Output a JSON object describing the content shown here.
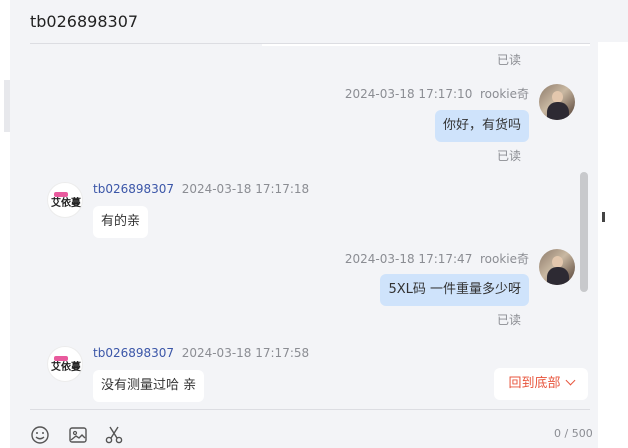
{
  "header": {
    "title": "tb026898307"
  },
  "read_label": "已读",
  "messages": [
    {
      "sender": "rookie奇",
      "time": "2024-03-18 17:17:10",
      "text": "你好，有货吗",
      "read": "已读"
    },
    {
      "sender": "tb026898307",
      "time": "2024-03-18 17:17:18",
      "text": "有的亲"
    },
    {
      "sender": "rookie奇",
      "time": "2024-03-18 17:17:47",
      "text": "5XL码 一件重量多少呀",
      "read": "已读"
    },
    {
      "sender": "tb026898307",
      "time": "2024-03-18 17:17:58",
      "text": "没有测量过哈 亲"
    }
  ],
  "shop_avatar_text": "艾依蔓",
  "back_to_bottom": "回到底部",
  "toolbar": {
    "icons": [
      "emoji-icon",
      "image-icon",
      "scissors-icon"
    ]
  },
  "counter": "0 / 500"
}
